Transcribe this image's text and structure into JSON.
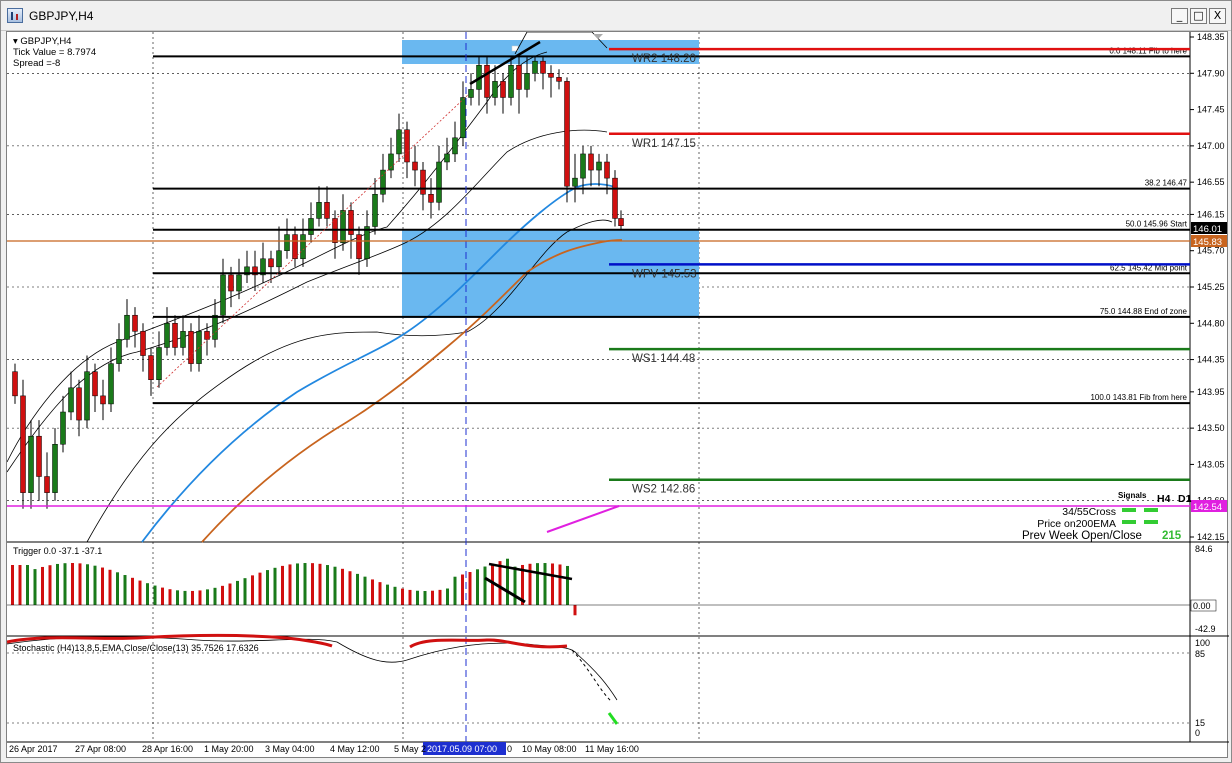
{
  "window": {
    "title": "GBPJPY,H4",
    "buttons": [
      "_",
      "□",
      "X"
    ]
  },
  "chart_header": {
    "symbol": "GBPJPY,H4",
    "tick_value": "Tick Value = 8.7974",
    "spread": "Spread =-8"
  },
  "price_axis": {
    "ticks": [
      "148.35",
      "147.90",
      "147.45",
      "147.00",
      "146.55",
      "146.15",
      "145.70",
      "145.25",
      "144.80",
      "144.35",
      "143.95",
      "143.50",
      "143.05",
      "142.60",
      "142.15"
    ],
    "bid_label": "146.01",
    "ema_label": "145.83",
    "magenta_label": "142.54"
  },
  "time_axis": {
    "labels": [
      "26 Apr 2017",
      "27 Apr 08:00",
      "28 Apr 16:00",
      "1 May 20:00",
      "3 May 04:00",
      "4 May 12:00",
      "5 May 2",
      "2017.05.09 07:00",
      "0",
      "10 May 08:00",
      "11 May 16:00"
    ]
  },
  "pivots": [
    {
      "name": "WR2",
      "value": "148.20",
      "color": "#e01010"
    },
    {
      "name": "WR1",
      "value": "147.15",
      "color": "#e01010"
    },
    {
      "name": "WPV",
      "value": "145.53",
      "color": "#0010c8"
    },
    {
      "name": "WS1",
      "value": "144.48",
      "color": "#1a7a1a"
    },
    {
      "name": "WS2",
      "value": "142.86",
      "color": "#1a7a1a"
    }
  ],
  "fib_levels": [
    {
      "pct": "0.0",
      "price": "148.11",
      "label": "Fib to here"
    },
    {
      "pct": "38.2",
      "price": "146.47",
      "label": ""
    },
    {
      "pct": "50.0",
      "price": "145.96",
      "label": "Start"
    },
    {
      "pct": "62.5",
      "price": "145.42",
      "label": "Mid point"
    },
    {
      "pct": "75.0",
      "price": "144.88",
      "label": "End of zone"
    },
    {
      "pct": "100.0",
      "price": "143.81",
      "label": "Fib from here"
    }
  ],
  "signals": {
    "title": "Signals",
    "cols": [
      "H4",
      "D1"
    ],
    "rows": [
      "34/55Cross",
      "Price on200EMA"
    ],
    "prev_week_label": "Prev Week Open/Close",
    "prev_week_value": "215"
  },
  "trigger_panel": {
    "label": "Trigger 0.0 -37.1 -37.1",
    "ticks": [
      "84.6",
      "0.00",
      "-42.9"
    ]
  },
  "stoch_panel": {
    "label": "Stochastic (H4)13,8,5,EMA,Close/Close(13) 35.7526 17.6326",
    "ticks": [
      "100",
      "85",
      "15",
      "0"
    ]
  },
  "colors": {
    "bull": "#1a7a1a",
    "bear": "#d01010",
    "zone": "#6ab8f0",
    "ema_fast": "#2288e0",
    "ema_slow": "#c8641e",
    "magenta": "#e020e0"
  }
}
